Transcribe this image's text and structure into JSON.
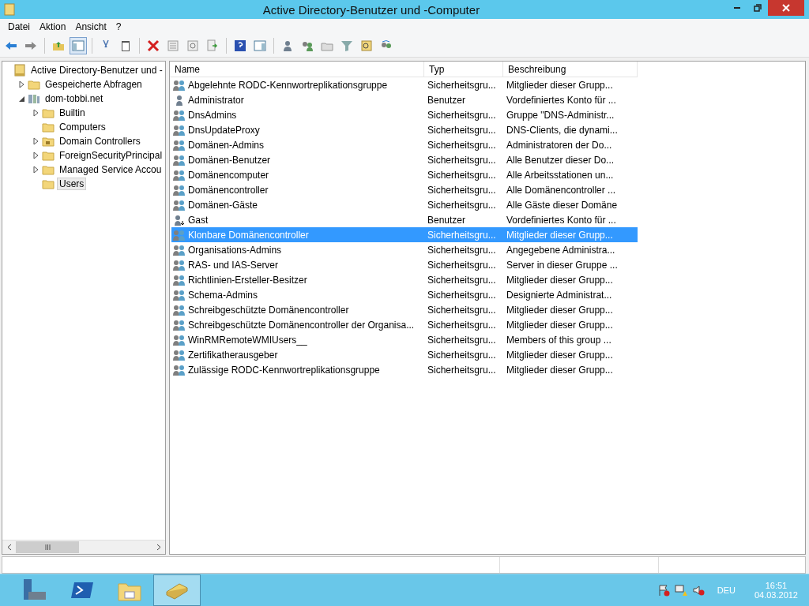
{
  "window": {
    "title": "Active Directory-Benutzer und -Computer"
  },
  "menu": [
    {
      "label": "Datei"
    },
    {
      "label": "Aktion"
    },
    {
      "label": "Ansicht"
    },
    {
      "label": "?"
    }
  ],
  "tree": [
    {
      "label": "Active Directory-Benutzer und -",
      "kind": "snapin",
      "expandable": false,
      "selected": false,
      "children": [
        {
          "label": "Gespeicherte Abfragen",
          "kind": "folder",
          "expandable": true,
          "expanded": false,
          "selected": false
        },
        {
          "label": "dom-tobbi.net",
          "kind": "domain",
          "expandable": true,
          "expanded": true,
          "selected": false,
          "children": [
            {
              "label": "Builtin",
              "kind": "folder",
              "expandable": true,
              "expanded": false,
              "selected": false
            },
            {
              "label": "Computers",
              "kind": "folder",
              "expandable": false,
              "selected": false
            },
            {
              "label": "Domain Controllers",
              "kind": "ou",
              "expandable": true,
              "expanded": false,
              "selected": false
            },
            {
              "label": "ForeignSecurityPrincipal",
              "kind": "folder",
              "expandable": true,
              "expanded": false,
              "selected": false
            },
            {
              "label": "Managed Service Accou",
              "kind": "folder",
              "expandable": true,
              "expanded": false,
              "selected": false
            },
            {
              "label": "Users",
              "kind": "folder",
              "expandable": false,
              "selected": true
            }
          ]
        }
      ]
    }
  ],
  "table": {
    "columns": [
      "Name",
      "Typ",
      "Beschreibung"
    ],
    "rows": [
      {
        "kind": "group",
        "selected": false,
        "cells": [
          "Abgelehnte RODC-Kennwortreplikationsgruppe",
          "Sicherheitsgru...",
          "Mitglieder dieser Grupp..."
        ]
      },
      {
        "kind": "user",
        "selected": false,
        "cells": [
          "Administrator",
          "Benutzer",
          "Vordefiniertes Konto für ..."
        ]
      },
      {
        "kind": "group",
        "selected": false,
        "cells": [
          "DnsAdmins",
          "Sicherheitsgru...",
          "Gruppe \"DNS-Administr..."
        ]
      },
      {
        "kind": "group",
        "selected": false,
        "cells": [
          "DnsUpdateProxy",
          "Sicherheitsgru...",
          "DNS-Clients, die dynami..."
        ]
      },
      {
        "kind": "group",
        "selected": false,
        "cells": [
          "Domänen-Admins",
          "Sicherheitsgru...",
          "Administratoren der Do..."
        ]
      },
      {
        "kind": "group",
        "selected": false,
        "cells": [
          "Domänen-Benutzer",
          "Sicherheitsgru...",
          "Alle Benutzer dieser Do..."
        ]
      },
      {
        "kind": "group",
        "selected": false,
        "cells": [
          "Domänencomputer",
          "Sicherheitsgru...",
          "Alle Arbeitsstationen un..."
        ]
      },
      {
        "kind": "group",
        "selected": false,
        "cells": [
          "Domänencontroller",
          "Sicherheitsgru...",
          "Alle Domänencontroller ..."
        ]
      },
      {
        "kind": "group",
        "selected": false,
        "cells": [
          "Domänen-Gäste",
          "Sicherheitsgru...",
          "Alle Gäste dieser Domäne"
        ]
      },
      {
        "kind": "disabled-user",
        "selected": false,
        "cells": [
          "Gast",
          "Benutzer",
          "Vordefiniertes Konto für ..."
        ]
      },
      {
        "kind": "group",
        "selected": true,
        "cells": [
          "Klonbare Domänencontroller",
          "Sicherheitsgru...",
          "Mitglieder dieser Grupp..."
        ]
      },
      {
        "kind": "group",
        "selected": false,
        "cells": [
          "Organisations-Admins",
          "Sicherheitsgru...",
          "Angegebene Administra..."
        ]
      },
      {
        "kind": "group",
        "selected": false,
        "cells": [
          "RAS- und IAS-Server",
          "Sicherheitsgru...",
          "Server in dieser Gruppe ..."
        ]
      },
      {
        "kind": "group",
        "selected": false,
        "cells": [
          "Richtlinien-Ersteller-Besitzer",
          "Sicherheitsgru...",
          "Mitglieder dieser Grupp..."
        ]
      },
      {
        "kind": "group",
        "selected": false,
        "cells": [
          "Schema-Admins",
          "Sicherheitsgru...",
          "Designierte Administrat..."
        ]
      },
      {
        "kind": "group",
        "selected": false,
        "cells": [
          "Schreibgeschützte Domänencontroller",
          "Sicherheitsgru...",
          "Mitglieder dieser Grupp..."
        ]
      },
      {
        "kind": "group",
        "selected": false,
        "cells": [
          "Schreibgeschützte Domänencontroller der Organisa...",
          "Sicherheitsgru...",
          "Mitglieder dieser Grupp..."
        ]
      },
      {
        "kind": "group",
        "selected": false,
        "cells": [
          "WinRMRemoteWMIUsers__",
          "Sicherheitsgru...",
          "Members of this group ..."
        ]
      },
      {
        "kind": "group",
        "selected": false,
        "cells": [
          "Zertifikatherausgeber",
          "Sicherheitsgru...",
          "Mitglieder dieser Grupp..."
        ]
      },
      {
        "kind": "group",
        "selected": false,
        "cells": [
          "Zulässige RODC-Kennwortreplikationsgruppe",
          "Sicherheitsgru...",
          "Mitglieder dieser Grupp..."
        ]
      }
    ]
  },
  "taskbar": {
    "apps": [
      {
        "kind": "server-manager",
        "selected": false
      },
      {
        "kind": "powershell",
        "selected": false
      },
      {
        "kind": "explorer",
        "selected": false
      },
      {
        "kind": "ad-tool",
        "selected": true
      }
    ],
    "tray": {
      "language": "DEU",
      "time": "16:51",
      "date": "04.03.2012"
    }
  }
}
